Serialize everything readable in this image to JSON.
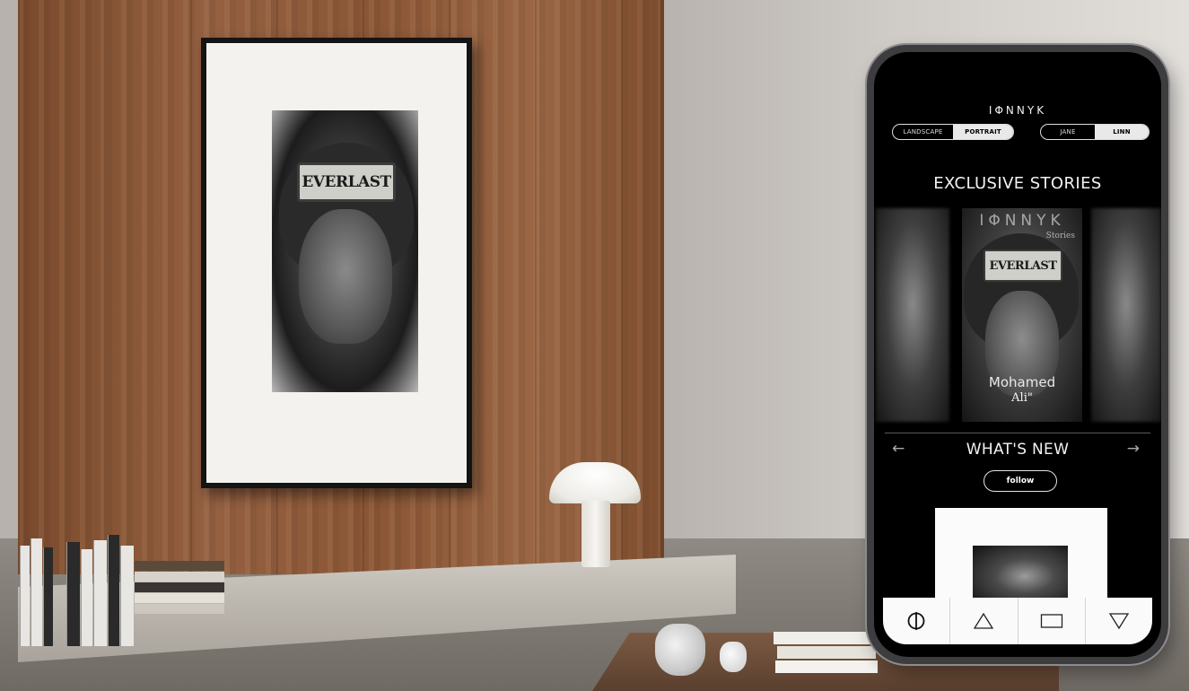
{
  "artwork": {
    "helmet_text": "EVERLAST"
  },
  "app": {
    "logo": "IΦNNYK",
    "orientation_toggle": {
      "options": [
        "LANDSCAPE",
        "PORTRAIT"
      ],
      "selected": "PORTRAIT"
    },
    "user_toggle": {
      "options": [
        "JANE",
        "LINN"
      ],
      "selected": "LINN"
    },
    "exclusive_section": {
      "heading": "EXCLUSIVE STORIES",
      "featured_story": {
        "brand": "IΦNNYK",
        "subtitle": "Stories",
        "helmet_text": "EVERLAST",
        "name_line1": "Mohamed",
        "name_line2": "Ali\""
      }
    },
    "whats_new": {
      "heading": "WHAT'S NEW",
      "prev_icon": "←",
      "next_icon": "→",
      "follow_label": "follow"
    },
    "bottom_nav": {
      "icons": [
        "circle-line-icon",
        "triangle-up-icon",
        "rectangle-icon",
        "triangle-down-icon"
      ]
    }
  }
}
